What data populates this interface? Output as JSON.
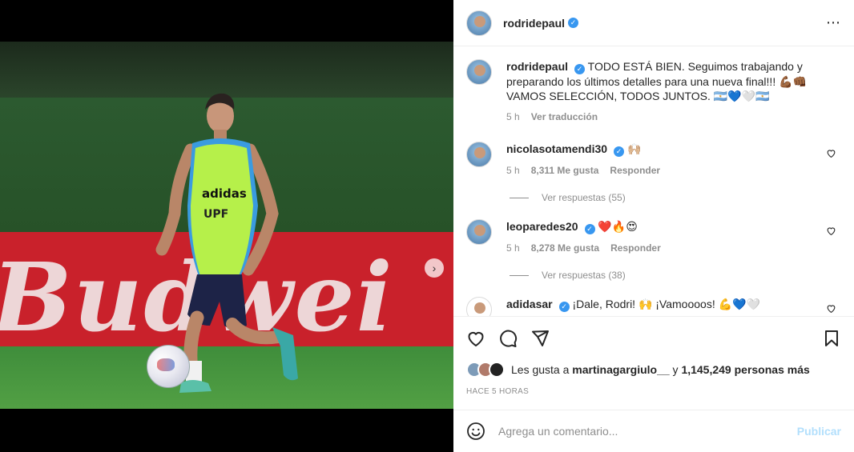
{
  "post": {
    "author": "rodridepaul",
    "more_icon": "⋯"
  },
  "media": {
    "banner_text": "Budwei",
    "sponsor_text": "adidas",
    "next_icon": "›"
  },
  "caption": {
    "username": "rodridepaul",
    "text": "TODO ESTÁ BIEN. Seguimos trabajando y preparando los últimos detalles para una nueva final!!! 💪🏾👊🏾 VAMOS SELECCIÓN, TODOS JUNTOS. 🇦🇷💙🤍🇦🇷",
    "time": "5 h",
    "translate": "Ver traducción"
  },
  "comments": [
    {
      "username": "nicolasotamendi30",
      "text": "🙌🏼",
      "time": "5 h",
      "likes": "8,311 Me gusta",
      "reply": "Responder",
      "replies": "Ver respuestas (55)"
    },
    {
      "username": "leoparedes20",
      "text": "❤️🔥😍",
      "time": "5 h",
      "likes": "8,278 Me gusta",
      "reply": "Responder",
      "replies": "Ver respuestas (38)"
    },
    {
      "username": "adidasar",
      "text": "¡Dale, Rodri! 🙌 ¡Vamoooos! 💪💙🤍"
    }
  ],
  "actions": {
    "liked_by_prefix": "Les gusta a",
    "liked_by_user": "martinagargiulo__",
    "liked_by_join": "y",
    "liked_by_count": "1,145,249 personas más",
    "timestamp": "HACE 5 HORAS"
  },
  "composer": {
    "placeholder": "Agrega un comentario...",
    "post_label": "Publicar"
  },
  "colors": {
    "verified": "#3897f0",
    "post_button": "#b2dffc",
    "banner_red": "#c9212b"
  }
}
